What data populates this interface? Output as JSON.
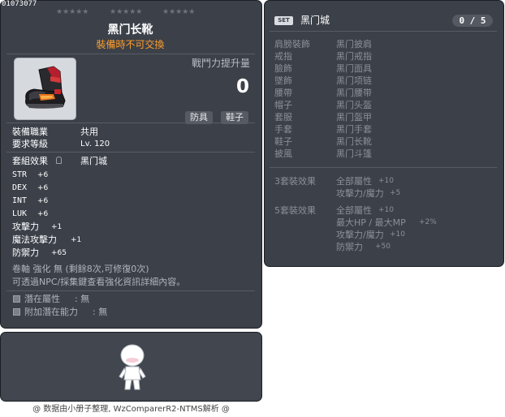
{
  "item": {
    "id": "01073077",
    "stars_1": "★★★★★",
    "stars_2": "★★★★★",
    "stars_3": "★★★★★",
    "name": "黑门长靴",
    "trade_status": "裝備時不可交換",
    "combat_power_label": "戰鬥力提升量",
    "combat_power_value": "0",
    "tags": [
      "防具",
      "鞋子"
    ],
    "job_label": "裝備職業",
    "job_value": "共用",
    "level_label": "要求等級",
    "level_value": "Lv. 120",
    "set_label": "套組效果",
    "set_value": "黑门城",
    "stats": [
      {
        "name": "STR",
        "value": "+6"
      },
      {
        "name": "DEX",
        "value": "+6"
      },
      {
        "name": "INT",
        "value": "+6"
      },
      {
        "name": "LUK",
        "value": "+6"
      },
      {
        "name": "攻擊力",
        "value": "+1"
      },
      {
        "name": "魔法攻擊力",
        "value": "+1"
      },
      {
        "name": "防禦力",
        "value": "+65"
      }
    ],
    "scroll_info": "卷軸 強化 無 (剩餘8次,可修復0次)",
    "npc_info": "可透過NPC/採集鍵查看強化資訊詳細內容。",
    "potential_label": "潛在屬性",
    "potential_value": ": 無",
    "additional_label": "附加潛在能力",
    "additional_value": ": 無"
  },
  "set": {
    "badge": "SET",
    "name": "黑门城",
    "count": "0 / 5",
    "slots": [
      {
        "type": "肩膀裝飾",
        "item": "黑门披肩"
      },
      {
        "type": "戒指",
        "item": "黑门戒指"
      },
      {
        "type": "臉飾",
        "item": "黑门面具"
      },
      {
        "type": "墜飾",
        "item": "黑门项链"
      },
      {
        "type": "腰帶",
        "item": "黑门腰带"
      },
      {
        "type": "帽子",
        "item": "黑门头盔"
      },
      {
        "type": "套服",
        "item": "黑门盔甲"
      },
      {
        "type": "手套",
        "item": "黑门手套"
      },
      {
        "type": "鞋子",
        "item": "黑门长靴"
      },
      {
        "type": "披風",
        "item": "黑门斗篷"
      }
    ],
    "effect3_label": "3套裝效果",
    "effect3": [
      {
        "name": "全部屬性",
        "value": "+10"
      },
      {
        "name": "攻擊力/魔力",
        "value": "+5"
      }
    ],
    "effect5_label": "5套裝效果",
    "effect5": [
      {
        "name": "全部屬性",
        "value": "+10"
      },
      {
        "name": "最大HP / 最大MP",
        "value": "+2%"
      },
      {
        "name": "攻擊力/魔力",
        "value": "+10"
      },
      {
        "name": "防禦力",
        "value": "+50"
      }
    ]
  },
  "footer": "@ 数据由小册子整理, WzComparerR2-NTMS解析 @",
  "colors": {
    "panel_bg": "#3b4049",
    "trade_orange": "#ff9e2c",
    "set_text_grey": "#8b9098"
  }
}
